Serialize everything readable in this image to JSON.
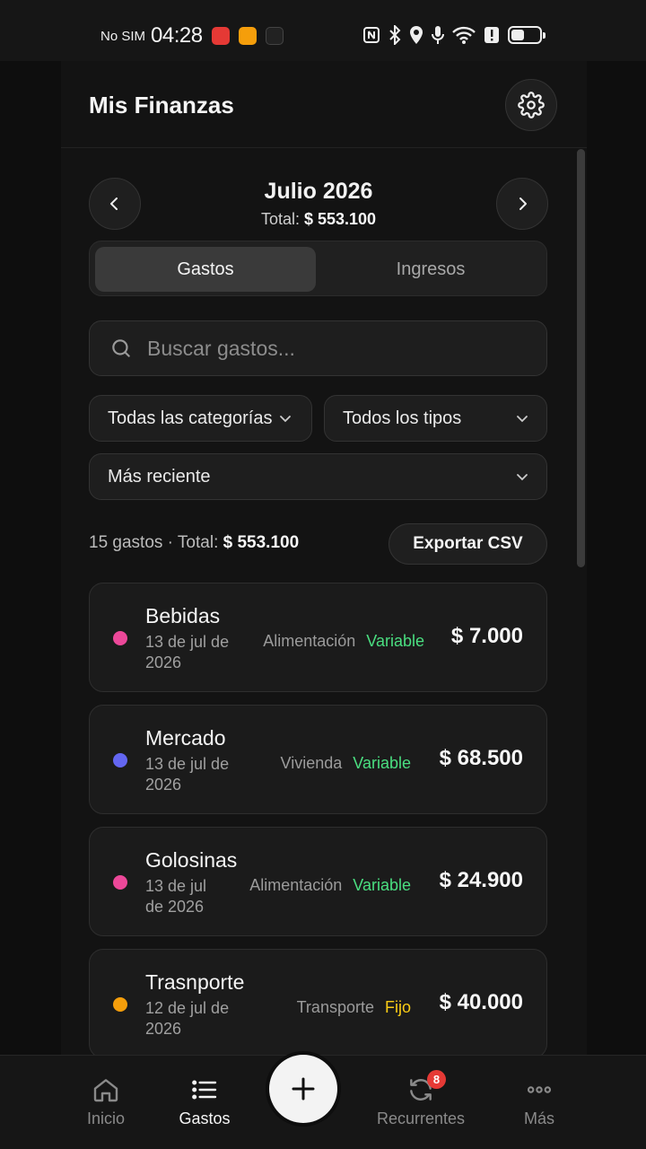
{
  "status_bar": {
    "carrier": "No SIM",
    "time": "04:28"
  },
  "header": {
    "title": "Mis Finanzas",
    "settings_icon": "gear-icon"
  },
  "month": {
    "title": "Julio 2026",
    "total_label": "Total:",
    "total_value": "$ 553.100"
  },
  "tabs": [
    {
      "label": "Gastos",
      "active": true
    },
    {
      "label": "Ingresos",
      "active": false
    }
  ],
  "search": {
    "placeholder": "Buscar gastos..."
  },
  "filters": {
    "category": "Todas las categorías",
    "type": "Todos los tipos",
    "sort": "Más reciente"
  },
  "summary": {
    "count_text": "15 gastos · Total:",
    "total_value": "$ 553.100",
    "export_label": "Exportar CSV"
  },
  "expenses": [
    {
      "name": "Bebidas",
      "date": "13 de jul de 2026",
      "category": "Alimentación",
      "type": "Variable",
      "amount": "$ 7.000",
      "dot_color": "#ec4899",
      "type_color": "#4ade80"
    },
    {
      "name": "Mercado",
      "date": "13 de jul de 2026",
      "category": "Vivienda",
      "type": "Variable",
      "amount": "$ 68.500",
      "dot_color": "#6366f1",
      "type_color": "#4ade80"
    },
    {
      "name": "Golosinas",
      "date": "13 de jul de 2026",
      "category": "Alimentación",
      "type": "Variable",
      "amount": "$ 24.900",
      "dot_color": "#ec4899",
      "type_color": "#4ade80"
    },
    {
      "name": "Trasnporte",
      "date": "12 de jul de 2026",
      "category": "Transporte",
      "type": "Fijo",
      "amount": "$ 40.000",
      "dot_color": "#f59e0b",
      "type_color": "#facc15"
    }
  ],
  "bottom_nav": {
    "items": [
      {
        "label": "Inicio",
        "icon": "home-icon"
      },
      {
        "label": "Gastos",
        "icon": "list-icon"
      },
      {
        "label": "Recurrentes",
        "icon": "refresh-icon",
        "badge": "8"
      },
      {
        "label": "Más",
        "icon": "more-icon"
      }
    ],
    "add_icon": "plus-icon"
  }
}
